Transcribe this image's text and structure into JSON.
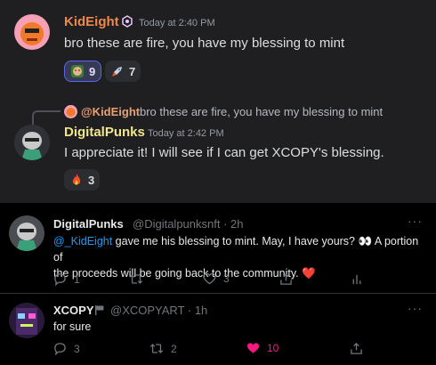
{
  "discord": {
    "messages": [
      {
        "author": "KidEight",
        "author_color": "#f1884b",
        "timestamp": "Today at 2:40 PM",
        "text": "bro these are fire, you have my blessing to mint",
        "reactions": [
          {
            "emoji": "face-emoji",
            "count": "9"
          },
          {
            "emoji": "rocket-emoji",
            "count": "7"
          }
        ]
      },
      {
        "reply": {
          "author": "@KidEight",
          "text": "bro these are fire, you have my blessing to mint"
        },
        "author": "DigitalPunks",
        "author_color": "#f0e68c",
        "timestamp": "Today at 2:42 PM",
        "text": "I appreciate it! I will see if I can get XCOPY's blessing.",
        "reactions": [
          {
            "emoji": "fire-emoji",
            "count": "3"
          }
        ]
      }
    ]
  },
  "twitter": {
    "tweets": [
      {
        "name": "DigitalPunks",
        "handle_time": "@Digitalpunksnft · 2h",
        "mention": "@_KidEight",
        "text_after_mention": " gave me his blessing to mint. May, I have yours? 👀 A portion of",
        "text_line2": "the proceeds will be going back to the community. ❤️",
        "actions": {
          "replies": "1",
          "retweets": "",
          "likes": "3"
        }
      },
      {
        "name": "XCOPY",
        "handle_time": "@XCOPYART · 1h",
        "text": "for sure",
        "actions": {
          "replies": "3",
          "retweets": "2",
          "likes": "10"
        }
      }
    ],
    "more_label": "···"
  }
}
